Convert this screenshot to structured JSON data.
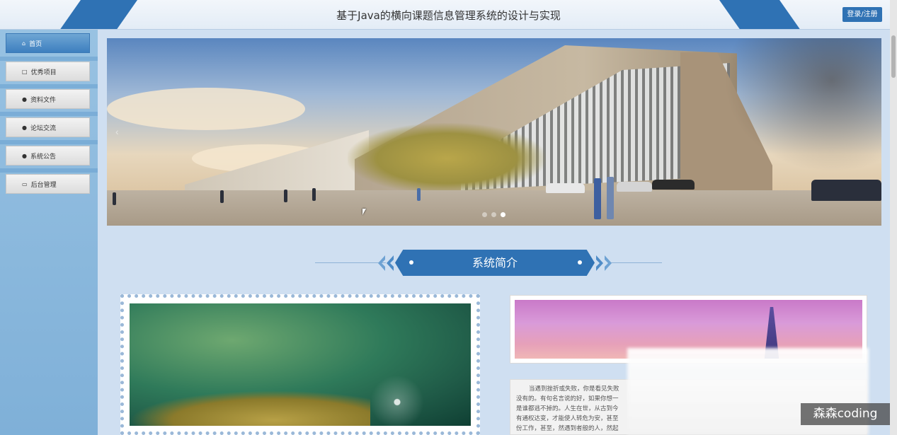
{
  "header": {
    "title": "基于Java的横向课题信息管理系统的设计与实现",
    "login_label": "登录/注册"
  },
  "sidebar": {
    "items": [
      {
        "label": "首页",
        "icon": "home-icon",
        "glyph": "⌂"
      },
      {
        "label": "优秀项目",
        "icon": "bag-icon",
        "glyph": "□"
      },
      {
        "label": "资料文件",
        "icon": "info-icon",
        "glyph": "●"
      },
      {
        "label": "论坛交流",
        "icon": "question-icon",
        "glyph": "●"
      },
      {
        "label": "系统公告",
        "icon": "info-icon",
        "glyph": "●"
      },
      {
        "label": "后台管理",
        "icon": "archive-icon",
        "glyph": "▭"
      }
    ]
  },
  "banner": {
    "slide_count": 3,
    "active_slide": 3,
    "prev_glyph": "‹"
  },
  "section": {
    "title": "系统简介"
  },
  "intro": {
    "lines": [
      "当遇到挫折或失败，你是看见失败",
      "没有的。有句名言说的好，如果你想一",
      "是谁都逃不掉的。人生在世，从古到今",
      "有通权达变，才能使人转危为安，甚至",
      "份工作，甚至，然遇到者般的人，然起"
    ]
  },
  "watermark": {
    "text": "森森coding"
  },
  "colors": {
    "accent": "#2f72b4",
    "sidebar": "#8ab8de",
    "page": "#cfdff1"
  }
}
